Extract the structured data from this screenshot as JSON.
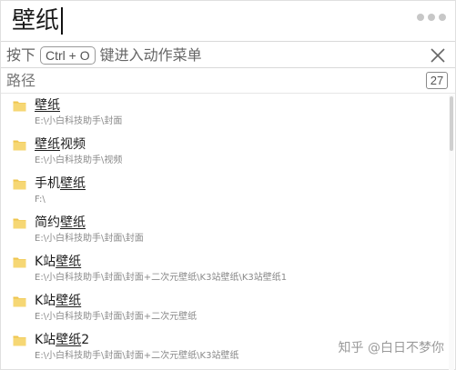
{
  "search": {
    "query": "壁纸"
  },
  "hint": {
    "prefix": "按下",
    "shortcut": "Ctrl + O",
    "suffix": "键进入动作菜单"
  },
  "section": {
    "label": "路径",
    "count": "27"
  },
  "results": [
    {
      "title_before": "",
      "title_match": "壁纸",
      "title_after": "",
      "path": "E:\\小白科技助手\\封面"
    },
    {
      "title_before": "",
      "title_match": "壁纸",
      "title_after": "视频",
      "path": "E:\\小白科技助手\\视频"
    },
    {
      "title_before": "手机",
      "title_match": "壁纸",
      "title_after": "",
      "path": "F:\\"
    },
    {
      "title_before": "简约",
      "title_match": "壁纸",
      "title_after": "",
      "path": "E:\\小白科技助手\\封面\\封面"
    },
    {
      "title_before": "K站",
      "title_match": "壁纸",
      "title_after": "",
      "path": "E:\\小白科技助手\\封面\\封面+二次元壁纸\\K3站壁纸\\K3站壁纸1"
    },
    {
      "title_before": "K站",
      "title_match": "壁纸",
      "title_after": "",
      "path": "E:\\小白科技助手\\封面\\封面+二次元壁纸"
    },
    {
      "title_before": "K站",
      "title_match": "壁纸",
      "title_after": "2",
      "path": "E:\\小白科技助手\\封面\\封面+二次元壁纸\\K3站壁纸"
    }
  ],
  "watermark": "知乎 @白日不梦你",
  "icons": {
    "more": "more-dots-icon",
    "close": "close-icon",
    "folder": "folder-icon"
  },
  "colors": {
    "folder": "#f6d774",
    "folder_tab": "#efc54e",
    "border": "#d9d9d9"
  }
}
